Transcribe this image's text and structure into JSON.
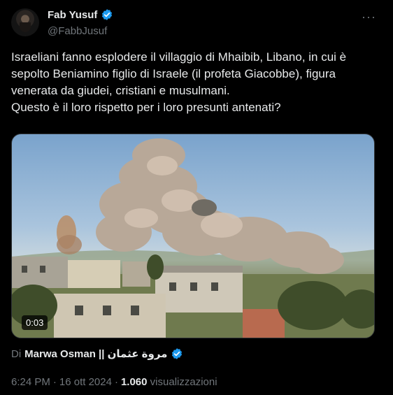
{
  "author": {
    "display_name": "Fab Yusuf",
    "handle": "@FabbJusuf"
  },
  "tweet": {
    "text": "Israeliani fanno esplodere il villaggio di Mhaibib, Libano, in cui è sepolto Beniamino figlio di Israele (il profeta Giacobbe), figura venerata da giudei, cristiani e musulmani.\nQuesto è il loro rispetto per i loro presunti antenati?"
  },
  "media": {
    "duration": "0:03"
  },
  "credit": {
    "prefix": "Di",
    "name": "Marwa Osman || مروة عثمان"
  },
  "meta": {
    "time": "6:24 PM",
    "date": "16 ott 2024",
    "views_count": "1.060",
    "views_label": "visualizzazioni"
  },
  "colors": {
    "background": "#000000",
    "text": "#e7e9ea",
    "secondary_text": "#71767b",
    "verified": "#1d9bf0"
  },
  "icons": {
    "verified": "verified-badge-icon",
    "more": "more-options-icon"
  }
}
